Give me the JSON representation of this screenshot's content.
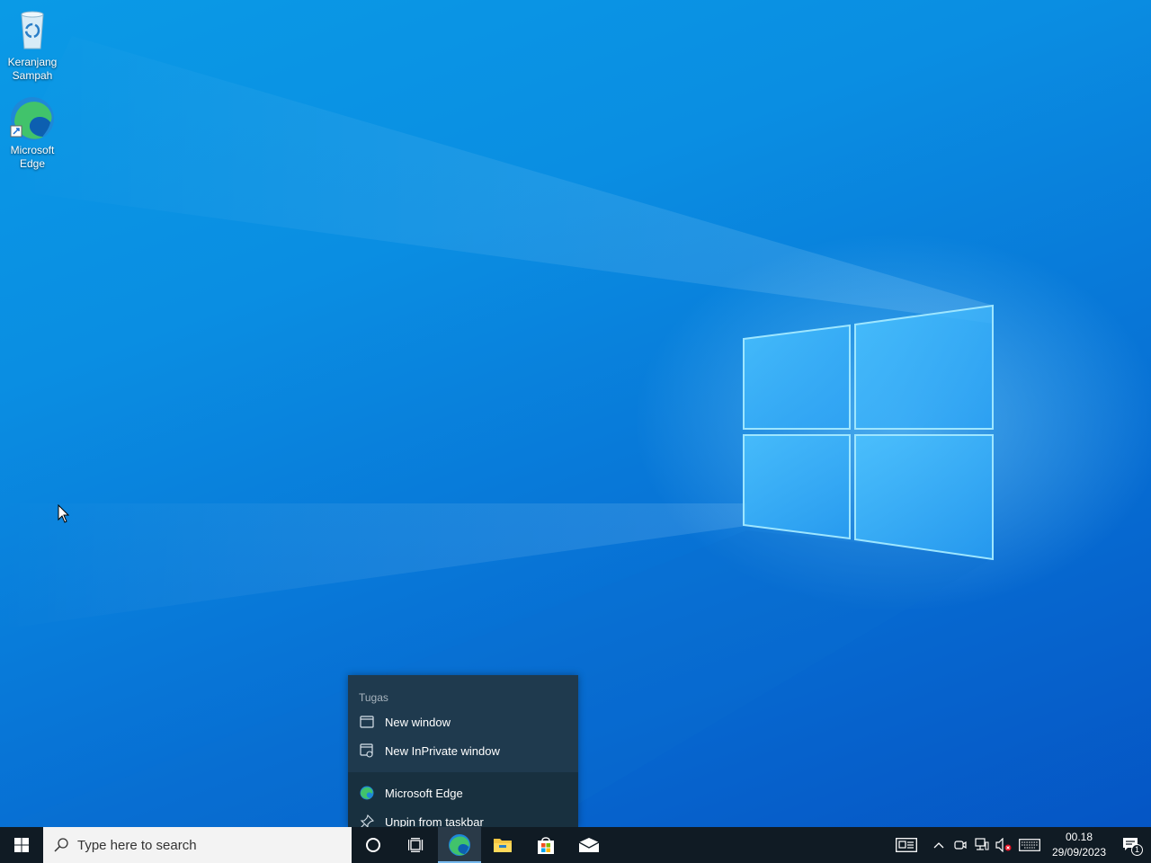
{
  "desktop": {
    "icons": [
      {
        "label": "Keranjang Sampah",
        "icon": "recycle-bin-icon"
      },
      {
        "label": "Microsoft Edge",
        "icon": "edge-icon"
      }
    ]
  },
  "jumplist": {
    "section_title": "Tugas",
    "tasks": [
      {
        "label": "New window",
        "icon": "window-icon"
      },
      {
        "label": "New InPrivate window",
        "icon": "inprivate-icon"
      }
    ],
    "app_items": [
      {
        "label": "Microsoft Edge",
        "icon": "edge-icon"
      },
      {
        "label": "Unpin from taskbar",
        "icon": "unpin-icon"
      }
    ]
  },
  "taskbar": {
    "search_placeholder": "Type here to search",
    "pinned": [
      "cortana-icon",
      "task-view-icon",
      "edge-icon",
      "file-explorer-icon",
      "store-icon",
      "mail-icon"
    ],
    "active_app": "edge-icon",
    "tray_icons": [
      "news-icon",
      "chevron-up-icon",
      "meet-now-icon",
      "network-icon",
      "volume-muted-icon",
      "keyboard-icon"
    ],
    "clock": {
      "time": "00.18",
      "date": "29/09/2023"
    },
    "notifications_count": "1"
  },
  "colors": {
    "accent": "#76b9ed",
    "taskbar_bg": "#101b24",
    "jumplist_bg": "#1f3a4e"
  }
}
